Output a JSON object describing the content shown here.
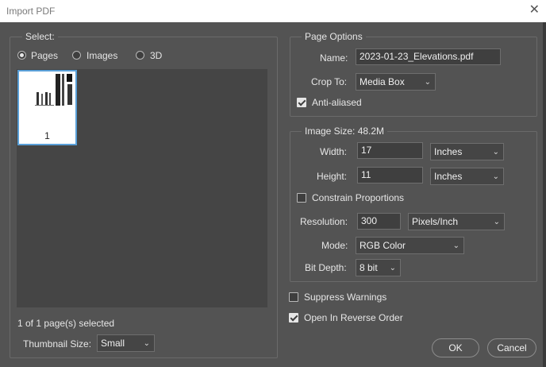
{
  "window": {
    "title": "Import PDF",
    "close_glyph": "✕"
  },
  "select": {
    "legend": "Select:",
    "options": [
      "Pages",
      "Images",
      "3D"
    ],
    "selected": "Pages",
    "thumbnail_page_number": "1",
    "status": "1 of 1 page(s) selected",
    "thumb_size_label": "Thumbnail Size:",
    "thumb_size_value": "Small"
  },
  "page_options": {
    "legend": "Page Options",
    "name_label": "Name:",
    "name_value": "2023-01-23_Elevations.pdf",
    "crop_label": "Crop To:",
    "crop_value": "Media Box",
    "anti_aliased_label": "Anti-aliased",
    "anti_aliased_checked": true
  },
  "image_size": {
    "legend": "Image Size: 48.2M",
    "width_label": "Width:",
    "width_value": "17",
    "width_unit": "Inches",
    "height_label": "Height:",
    "height_value": "11",
    "height_unit": "Inches",
    "constrain_label": "Constrain Proportions",
    "constrain_checked": false,
    "resolution_label": "Resolution:",
    "resolution_value": "300",
    "resolution_unit": "Pixels/Inch",
    "mode_label": "Mode:",
    "mode_value": "RGB Color",
    "bit_depth_label": "Bit Depth:",
    "bit_depth_value": "8 bit"
  },
  "options": {
    "suppress_label": "Suppress Warnings",
    "suppress_checked": false,
    "reverse_label": "Open In Reverse Order",
    "reverse_checked": true
  },
  "buttons": {
    "ok": "OK",
    "cancel": "Cancel"
  },
  "icons": {
    "dropdown": "chevron-down-icon"
  }
}
